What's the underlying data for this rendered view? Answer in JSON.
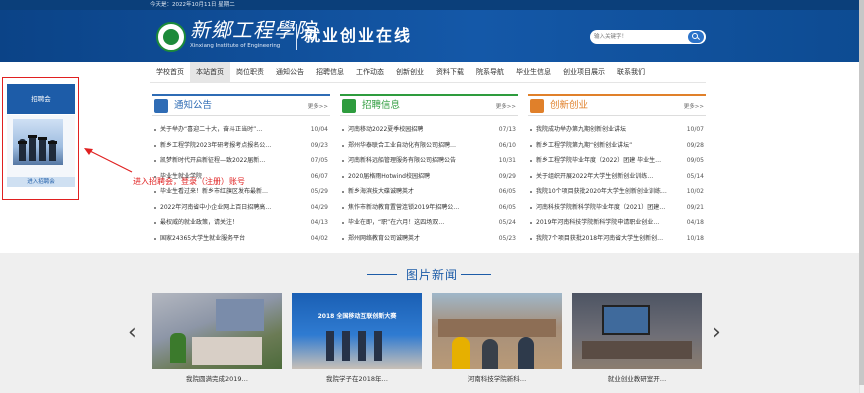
{
  "top_bar": {
    "date": "今天是：2022年10月11日   星期二"
  },
  "header": {
    "school_name": "新鄉工程學院",
    "school_en": "Xinxiang Institute of Engineering",
    "site_title": "就业创业在线",
    "search_placeholder": "输入关键字！"
  },
  "nav": {
    "items": [
      "学校首页",
      "本站首页",
      "岗位职责",
      "通知公告",
      "招聘信息",
      "工作动态",
      "创新创业",
      "资料下载",
      "院系导航",
      "毕业生信息",
      "创业项目展示",
      "联系我们"
    ],
    "active_index": 1
  },
  "recruit_widget": {
    "title": "招聘会",
    "label": "进入招聘会"
  },
  "callout": "进入招聘会，登录（注册）账号",
  "columns": [
    {
      "title": "通知公告",
      "more": "更多>>",
      "accent": "#2f6cb5",
      "items": [
        {
          "title": "关于举办“喜迎二十大，奋斗正当时”…",
          "date": "10/04"
        },
        {
          "title": "新乡工程学院2023年研考报考点报名公…",
          "date": "09/23"
        },
        {
          "title": "凯梦新时代开启新征程—致2022届新…",
          "date": "07/05"
        },
        {
          "title": "毕业生就业学院",
          "date": "06/07"
        },
        {
          "title": "毕业生看过来！新乡市红旗区发布最新…",
          "date": "05/29"
        },
        {
          "title": "2022年河南省中小企业网上百日招聘高…",
          "date": "04/29"
        },
        {
          "title": "最权威的就业政策，请关注！",
          "date": "04/13"
        },
        {
          "title": "国家24365大学生就业服务平台",
          "date": "04/02"
        }
      ]
    },
    {
      "title": "招聘信息",
      "more": "更多>>",
      "accent": "#2e9c3e",
      "items": [
        {
          "title": "河南移动2022夏季校园招聘",
          "date": "07/13"
        },
        {
          "title": "郑州华泰联合工业自动化有限公司招聘…",
          "date": "06/10"
        },
        {
          "title": "河南新科远船管理服务有限公司招聘公告",
          "date": "10/31"
        },
        {
          "title": "2020届格雨Hotwind校园招聘",
          "date": "09/29"
        },
        {
          "title": "新乡海滨技大碟诚聘英才",
          "date": "06/05"
        },
        {
          "title": "焦作市新动教育置营连锁2019年招聘公…",
          "date": "06/05"
        },
        {
          "title": "毕业在即，“职”在六月！这四场双…",
          "date": "05/24"
        },
        {
          "title": "郑州网络教育公司诚聘英才",
          "date": "05/23"
        }
      ]
    },
    {
      "title": "创新创业",
      "more": "更多>>",
      "accent": "#e0802a",
      "items": [
        {
          "title": "我院成功举办第九期创新创业讲坛",
          "date": "10/07"
        },
        {
          "title": "新乡工程学院第九期“创新创业讲坛”",
          "date": "09/28"
        },
        {
          "title": "新乡工程学院毕业年度（2022）团建 毕业生…",
          "date": "09/05"
        },
        {
          "title": "关于组织开展2022年大学生创新创业训练…",
          "date": "05/14"
        },
        {
          "title": "我院10个项目获批2020年大学生创新创业训练…",
          "date": "10/02"
        },
        {
          "title": "河南科技学院新科学院毕业年度（2021）团建…",
          "date": "09/21"
        },
        {
          "title": "2019年河南科技学院新科学院申请职业创业…",
          "date": "04/18"
        },
        {
          "title": "我院7个项目获批2018年河南省大学生创新创…",
          "date": "10/18"
        }
      ]
    }
  ],
  "photo_news": {
    "title": "图片新闻",
    "items": [
      {
        "caption": "我院圆满完成2019…"
      },
      {
        "caption": "我院学子在2018年…"
      },
      {
        "caption": "河南科技学院新科…"
      },
      {
        "caption": "就业创业教研室开…"
      }
    ],
    "second_banner_text": "2018 全国移动互联创新大赛"
  }
}
